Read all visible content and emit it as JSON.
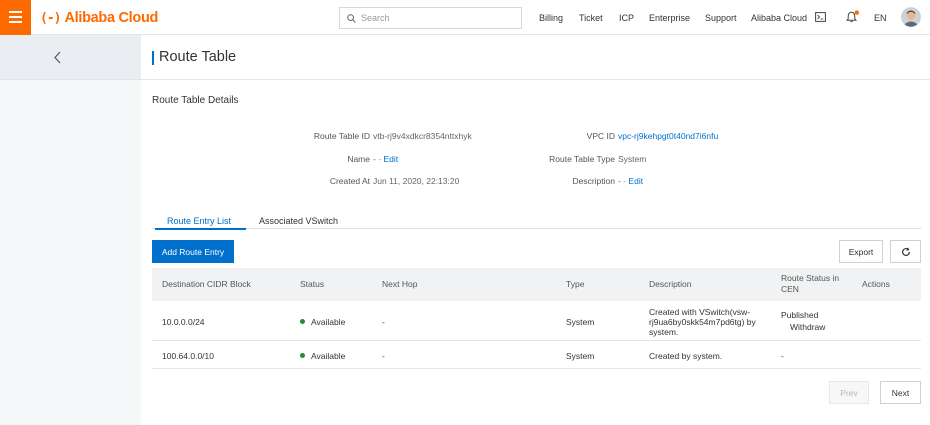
{
  "topbar": {
    "logo_mark": "(-)",
    "logo_text": "Alibaba Cloud",
    "search_placeholder": "Search",
    "nav": [
      "Billing",
      "Ticket",
      "ICP",
      "Enterprise",
      "Support",
      "Alibaba Cloud"
    ],
    "language": "EN",
    "brand_color": "#ff6a00"
  },
  "page": {
    "title": "Route Table",
    "section_title": "Route Table Details"
  },
  "details": {
    "route_table_id_label": "Route Table ID",
    "route_table_id_value": "vtb-rj9v4xdkcr8354nttxhyk",
    "name_label": "Name",
    "name_value": "-",
    "name_edit": "Edit",
    "created_at_label": "Created At",
    "created_at_value": "Jun 11, 2020, 22:13:20",
    "vpc_id_label": "VPC ID",
    "vpc_id_value": "vpc-rj9kehpgt0t40nd7i6nfu",
    "route_table_type_label": "Route Table Type",
    "route_table_type_value": "System",
    "description_label": "Description",
    "description_value": "-",
    "description_edit": "Edit"
  },
  "tabs": [
    {
      "label": "Route Entry List",
      "active": true
    },
    {
      "label": "Associated VSwitch",
      "active": false
    }
  ],
  "toolbar": {
    "add_label": "Add Route Entry",
    "export_label": "Export"
  },
  "table": {
    "headers": [
      "Destination CIDR Block",
      "Status",
      "Next Hop",
      "Type",
      "Description",
      "Route Status in CEN",
      "Actions"
    ],
    "rows": [
      {
        "cidr": "10.0.0.0/24",
        "status": "Available",
        "next_hop": "-",
        "type": "System",
        "description": "Created with VSwitch(vsw-rj9ua6by0skk54m7pd6tg) by system.",
        "cen_status": "Published",
        "cen_action": "Withdraw"
      },
      {
        "cidr": "100.64.0.0/10",
        "status": "Available",
        "next_hop": "-",
        "type": "System",
        "description": "Created by system.",
        "cen_status": "-",
        "cen_action": ""
      }
    ]
  },
  "pagination": {
    "prev_label": "Prev",
    "next_label": "Next"
  }
}
